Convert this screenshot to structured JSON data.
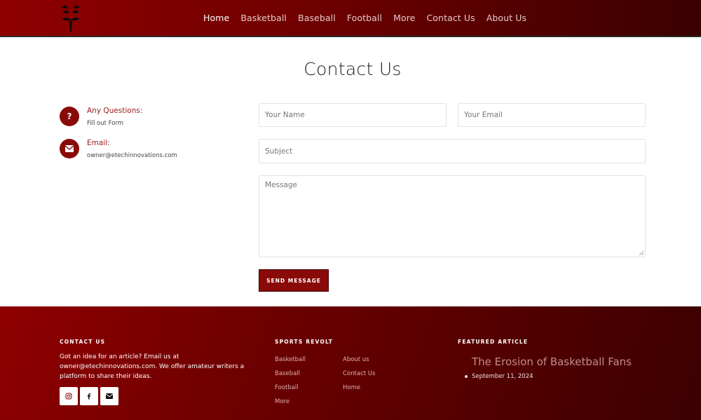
{
  "header": {
    "nav": [
      "Home",
      "Basketball",
      "Baseball",
      "Football",
      "More",
      "Contact Us",
      "About Us"
    ],
    "active": "Home"
  },
  "page": {
    "title": "Contact Us"
  },
  "contact_info": {
    "questions_label": "Any Questions:",
    "questions_value": "Fill out Form",
    "questions_icon": "question-icon",
    "email_label": "Email:",
    "email_value": "owner@etechinnovations.com",
    "email_icon": "envelope-icon"
  },
  "form": {
    "name_placeholder": "Your Name",
    "email_placeholder": "Your Email",
    "subject_placeholder": "Subject",
    "message_placeholder": "Message",
    "send_label": "SEND MESSAGE"
  },
  "footer": {
    "contact_heading": "CONTACT US",
    "contact_text": "Got an idea for an article? Email us at owner@etechinnovations.com. We offer amateur writers a platform to share their ideas.",
    "social_icons": [
      "instagram-icon",
      "facebook-icon",
      "envelope-icon"
    ],
    "sports_heading": "SPORTS REVOLT",
    "links_col1": [
      "Basketball",
      "Baseball",
      "Football",
      "More"
    ],
    "links_col2": [
      "About us",
      "Contact Us",
      "Home"
    ],
    "featured_heading": "FEATURED ARTICLE",
    "featured_title": "The Erosion of Basketball Fans",
    "featured_date": "September 11, 2024"
  },
  "colors": {
    "brand": "#8a0a0a",
    "header_gradient_start": "#8f0000",
    "header_gradient_end": "#3a0000"
  }
}
